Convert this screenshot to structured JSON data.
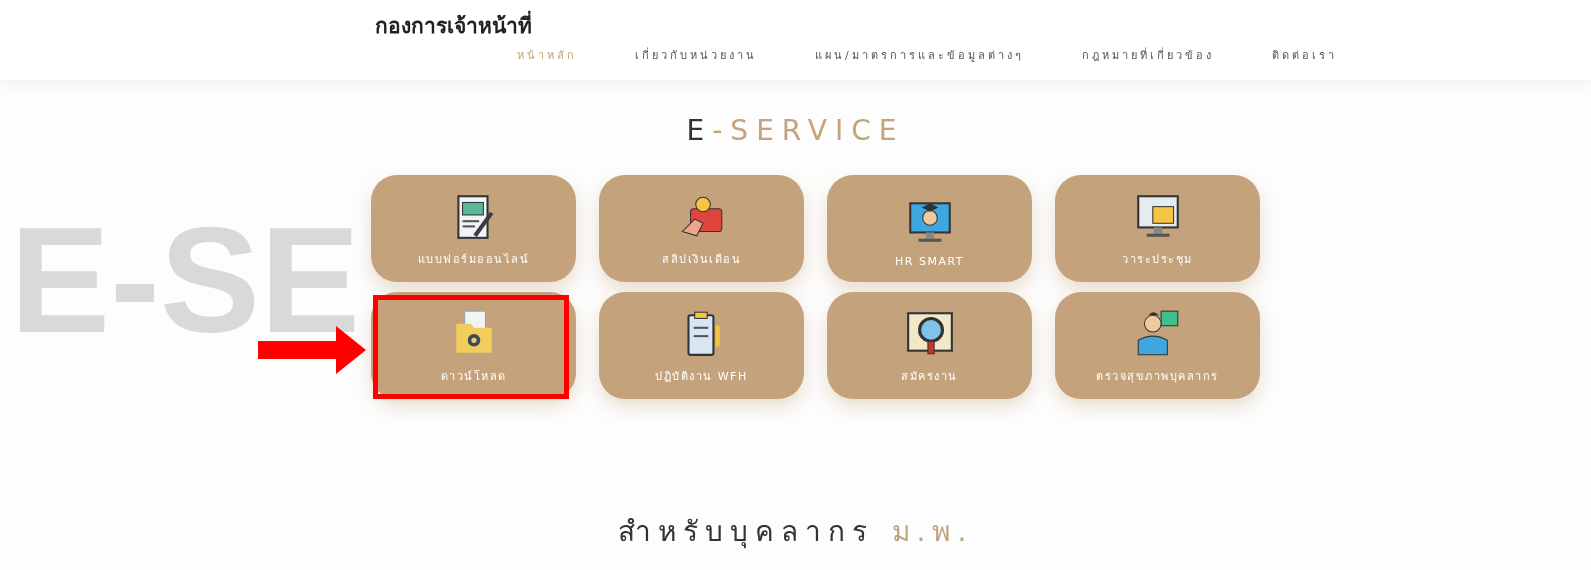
{
  "header": {
    "title": "กองการเจ้าหน้าที่",
    "nav": [
      {
        "label": "หน้าหลัก",
        "selected": true
      },
      {
        "label": "เกี่ยวกับหน่วยงาน",
        "selected": false
      },
      {
        "label": "แผน/มาตรการและข้อมูลต่างๆ",
        "selected": false
      },
      {
        "label": "กฎหมายที่เกี่ยวข้อง",
        "selected": false
      },
      {
        "label": "ติดต่อเรา",
        "selected": false
      }
    ]
  },
  "background_text": "E-SE",
  "eservice": {
    "heading": {
      "text": "E",
      "accent": "-SERVICE"
    },
    "tiles": [
      {
        "label": "แบบฟอร์มออนไลน์",
        "highlighted": false
      },
      {
        "label": "สลิปเงินเดือน",
        "highlighted": false
      },
      {
        "label": "HR SMART",
        "highlighted": false
      },
      {
        "label": "วาระประชุม",
        "highlighted": false
      },
      {
        "label": "ดาวน์โหลด",
        "highlighted": true
      },
      {
        "label": "ปฏิบัติงาน WFH",
        "highlighted": false
      },
      {
        "label": "สมัครงาน",
        "highlighted": false
      },
      {
        "label": "ตรวจสุขภาพบุคลากร",
        "highlighted": false
      }
    ]
  },
  "staff": {
    "heading": {
      "text": "สำหรับบุคลากร",
      "accent": "ม.พ."
    }
  }
}
